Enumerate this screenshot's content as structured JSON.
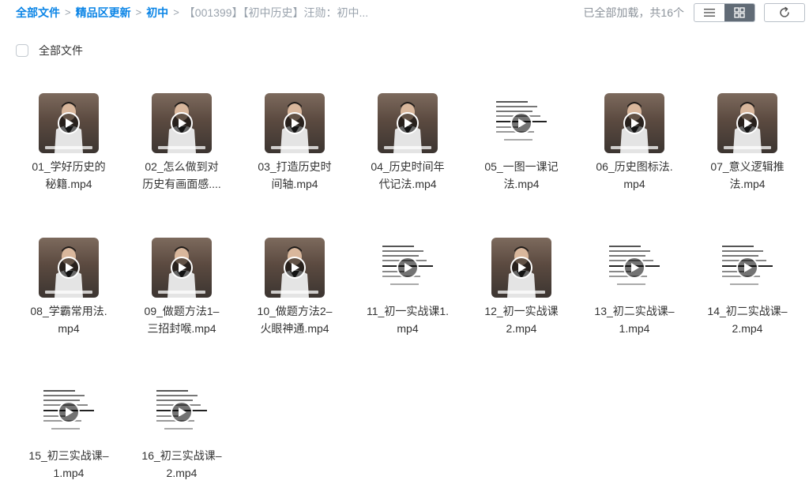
{
  "breadcrumb": {
    "items": [
      "全部文件",
      "精品区更新",
      "初中"
    ],
    "separator": ">",
    "current": "【001399】【初中历史】汪勋：初中..."
  },
  "status": {
    "load_text": "已全部加载，共16个"
  },
  "toolbar": {
    "list_view_icon": "list-icon",
    "grid_view_icon": "grid-icon",
    "refresh_icon": "refresh-icon",
    "active_view": "grid"
  },
  "select_all": {
    "label": "全部文件"
  },
  "colors": {
    "accent": "#0a84e6",
    "muted": "#9aa3ad"
  },
  "files": [
    {
      "name_line1": "01_学好历史的",
      "name_line2": "秘籍.mp4",
      "thumb": "person"
    },
    {
      "name_line1": "02_怎么做到对",
      "name_line2": "历史有画面感....",
      "thumb": "person"
    },
    {
      "name_line1": "03_打造历史时",
      "name_line2": "间轴.mp4",
      "thumb": "person"
    },
    {
      "name_line1": "04_历史时间年",
      "name_line2": "代记法.mp4",
      "thumb": "person"
    },
    {
      "name_line1": "05_一图一课记",
      "name_line2": "法.mp4",
      "thumb": "text"
    },
    {
      "name_line1": "06_历史图标法.",
      "name_line2": "mp4",
      "thumb": "person"
    },
    {
      "name_line1": "07_意义逻辑推",
      "name_line2": "法.mp4",
      "thumb": "person"
    },
    {
      "name_line1": "08_学霸常用法.",
      "name_line2": "mp4",
      "thumb": "person"
    },
    {
      "name_line1": "09_做题方法1–",
      "name_line2": "三招封喉.mp4",
      "thumb": "person"
    },
    {
      "name_line1": "10_做题方法2–",
      "name_line2": "火眼神通.mp4",
      "thumb": "person"
    },
    {
      "name_line1": "11_初一实战课1.",
      "name_line2": "mp4",
      "thumb": "text"
    },
    {
      "name_line1": "12_初一实战课",
      "name_line2": "2.mp4",
      "thumb": "person"
    },
    {
      "name_line1": "13_初二实战课–",
      "name_line2": "1.mp4",
      "thumb": "text"
    },
    {
      "name_line1": "14_初二实战课–",
      "name_line2": "2.mp4",
      "thumb": "text"
    },
    {
      "name_line1": "15_初三实战课–",
      "name_line2": "1.mp4",
      "thumb": "text"
    },
    {
      "name_line1": "16_初三实战课–",
      "name_line2": "2.mp4",
      "thumb": "text"
    }
  ]
}
